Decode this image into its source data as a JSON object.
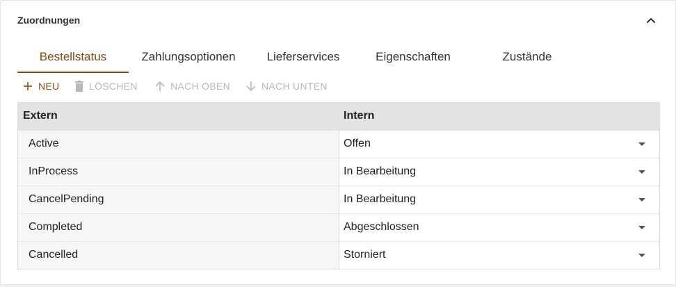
{
  "panel": {
    "title": "Zuordnungen",
    "collapse_icon": "chevron-up-icon"
  },
  "tabs": [
    {
      "label": "Bestellstatus",
      "active": true
    },
    {
      "label": "Zahlungsoptionen",
      "active": false
    },
    {
      "label": "Lieferservices",
      "active": false
    },
    {
      "label": "Eigenschaften",
      "active": false
    },
    {
      "label": "Zustände",
      "active": false
    }
  ],
  "toolbar": {
    "new_label": "NEU",
    "delete_label": "LÖSCHEN",
    "up_label": "NACH OBEN",
    "down_label": "NACH UNTEN"
  },
  "grid": {
    "columns": {
      "extern": "Extern",
      "intern": "Intern"
    },
    "rows": [
      {
        "extern": "Active",
        "intern": "Offen"
      },
      {
        "extern": "InProcess",
        "intern": "In Bearbeitung"
      },
      {
        "extern": "CancelPending",
        "intern": "In Bearbeitung"
      },
      {
        "extern": "Completed",
        "intern": "Abgeschlossen"
      },
      {
        "extern": "Cancelled",
        "intern": "Storniert"
      }
    ]
  },
  "colors": {
    "accent": "#8a4a12",
    "disabled": "#b8b8b8",
    "header_bg": "#e3e3e3",
    "extern_cell_bg": "#f6f6f6"
  }
}
